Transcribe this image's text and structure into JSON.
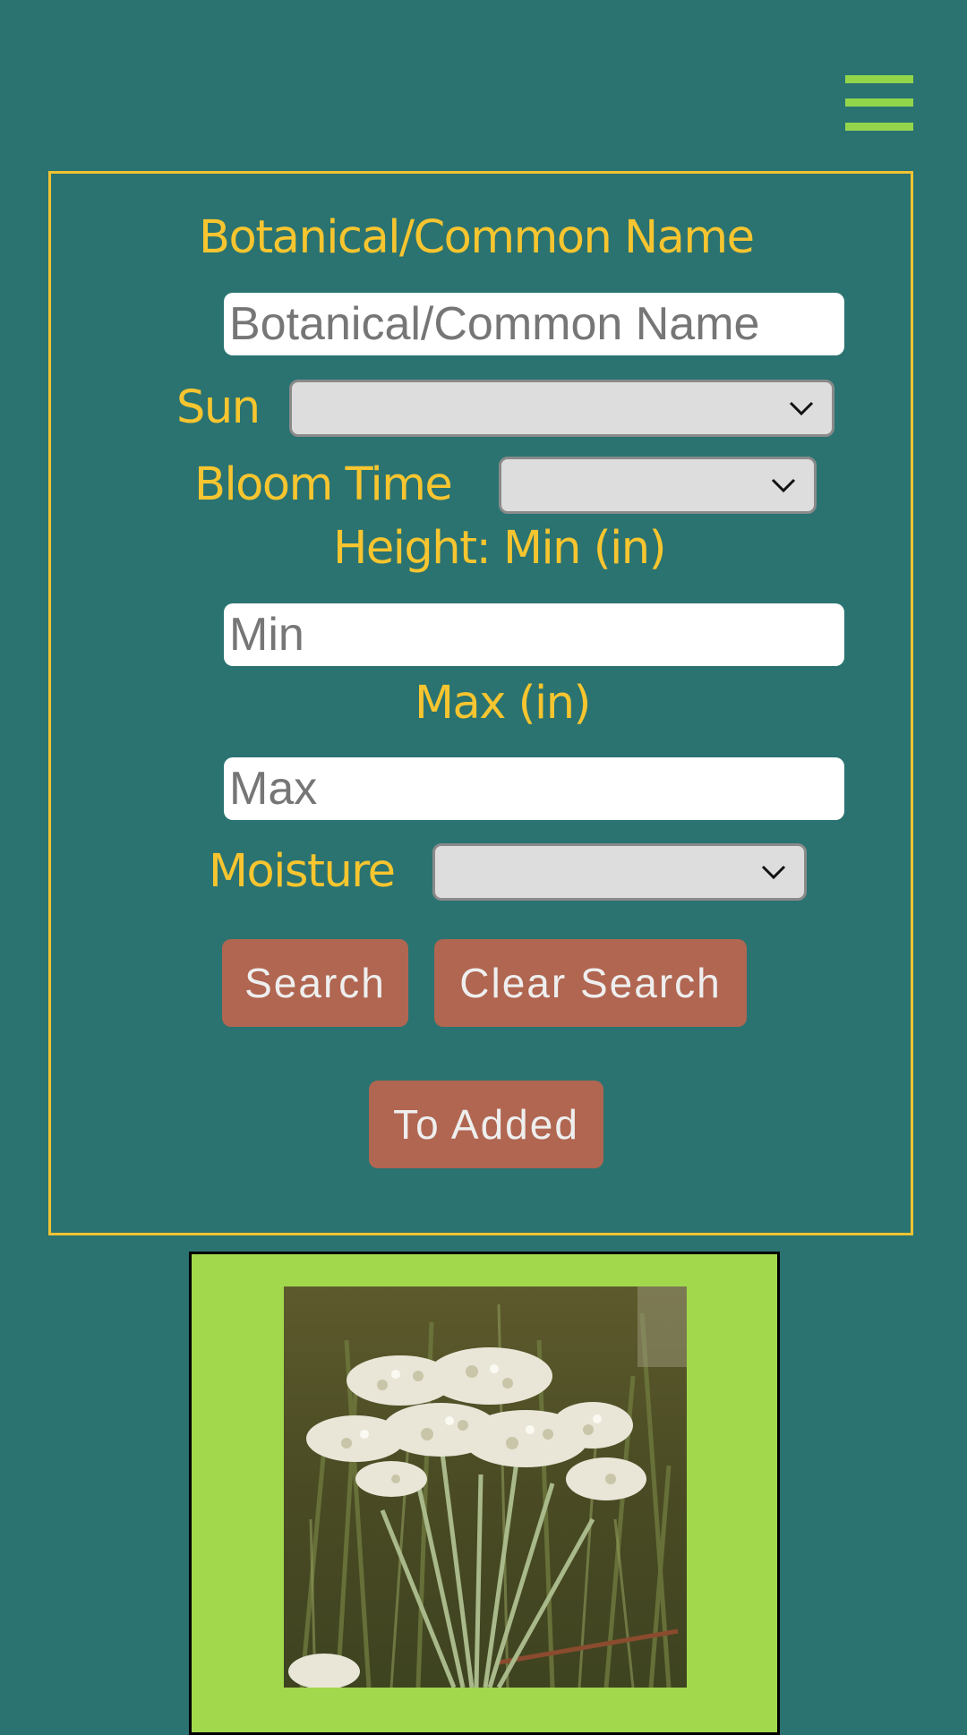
{
  "header": {
    "menu_icon": "hamburger-menu-icon",
    "menu_color": "#93d64c"
  },
  "search": {
    "name_label": "Botanical/Common Name",
    "name_placeholder": "Botanical/Common Name",
    "name_value": "",
    "sun_label": "Sun",
    "sun_selected": "",
    "bloom_label": "Bloom Time",
    "bloom_selected": "",
    "height_min_label": "Height: Min (in)",
    "min_placeholder": "Min",
    "min_value": "",
    "max_label": "Max (in)",
    "max_placeholder": "Max",
    "max_value": "",
    "moisture_label": "Moisture",
    "moisture_selected": "",
    "search_button": "Search",
    "clear_button": "Clear Search",
    "to_added_button": "To Added"
  },
  "colors": {
    "background": "#2a7371",
    "label": "#f7c52f",
    "panel_border": "#f1c232",
    "button": "#b06651",
    "card": "#a2d84c"
  },
  "results": [
    {
      "image_icon": "plant-photo-white-flowers"
    }
  ]
}
